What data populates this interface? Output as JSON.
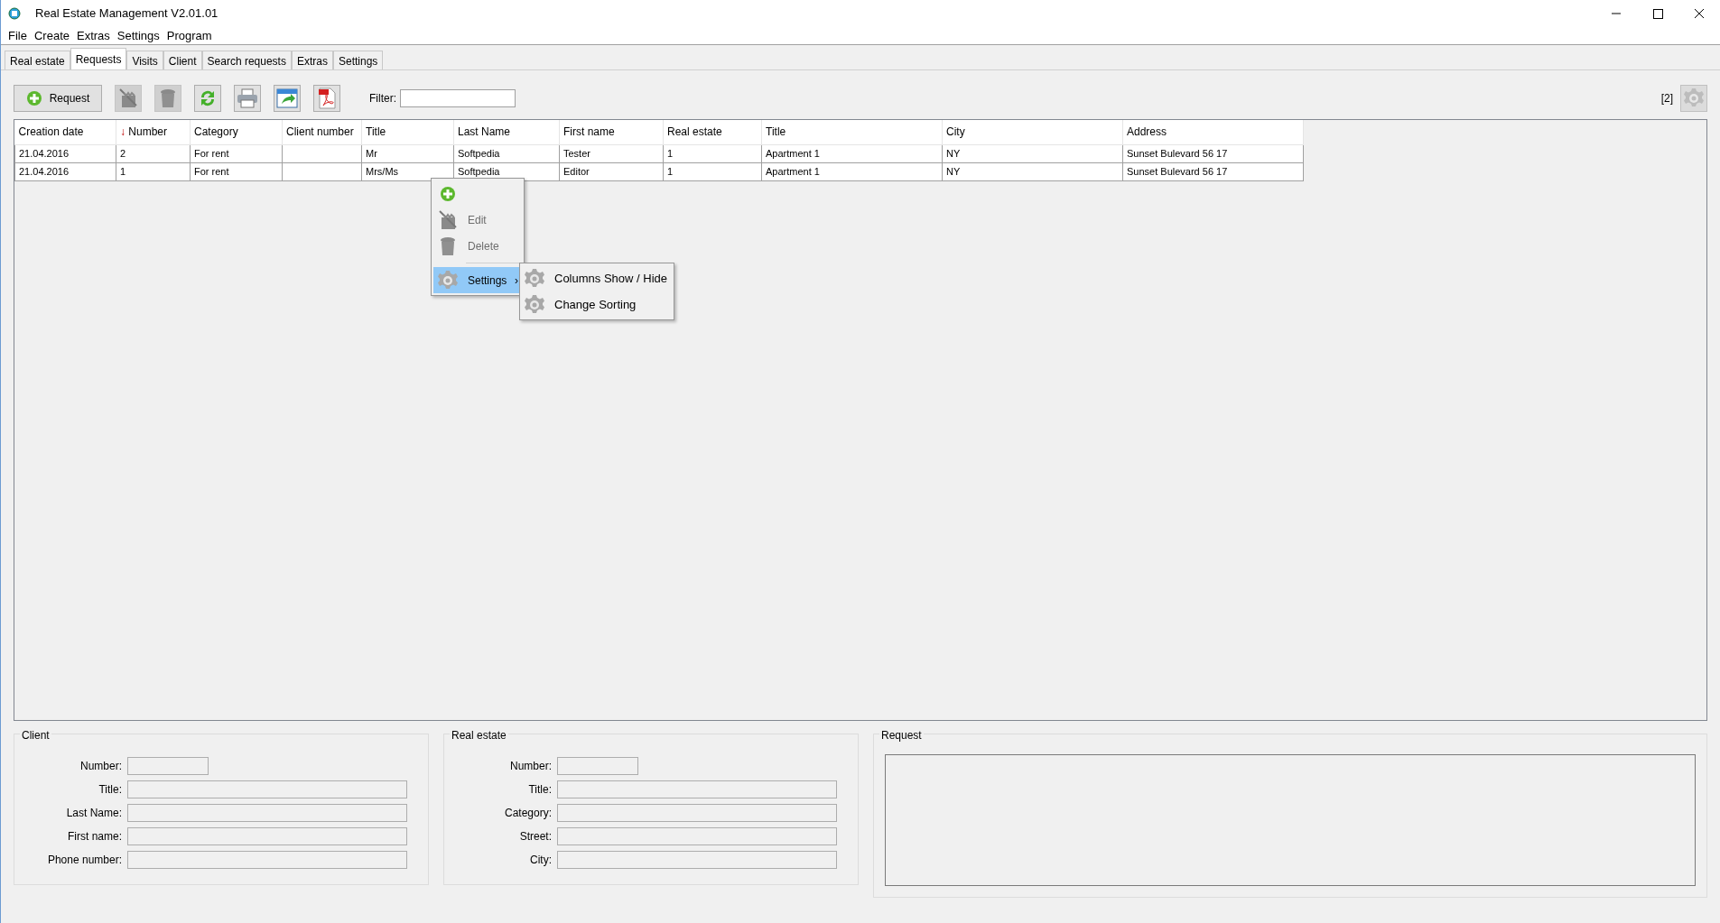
{
  "window": {
    "title": "Real Estate Management V2.01.01"
  },
  "menu": [
    "File",
    "Create",
    "Extras",
    "Settings",
    "Program"
  ],
  "tabs": [
    {
      "label": "Real estate",
      "selected": false
    },
    {
      "label": "Requests",
      "selected": true
    },
    {
      "label": "Visits",
      "selected": false
    },
    {
      "label": "Client",
      "selected": false
    },
    {
      "label": "Search requests",
      "selected": false
    },
    {
      "label": "Extras",
      "selected": false
    },
    {
      "label": "Settings",
      "selected": false
    }
  ],
  "toolbar": {
    "buttons": [
      {
        "kind": "add",
        "label": "Request",
        "disabled": false
      },
      {
        "kind": "edit",
        "disabled": true
      },
      {
        "kind": "delete",
        "disabled": true
      },
      {
        "kind": "refresh",
        "disabled": false
      },
      {
        "kind": "print",
        "disabled": false
      },
      {
        "kind": "export",
        "disabled": false
      },
      {
        "kind": "pdf",
        "disabled": false
      }
    ],
    "filter_label": "Filter:",
    "count": "[2]"
  },
  "table": {
    "columns": [
      {
        "label": "Creation date"
      },
      {
        "label": "Number",
        "sort_mark": "↓"
      },
      {
        "label": "Category"
      },
      {
        "label": "Client number"
      },
      {
        "label": "Title"
      },
      {
        "label": "Last Name"
      },
      {
        "label": "First name"
      },
      {
        "label": "Real estate"
      },
      {
        "label": "Title"
      },
      {
        "label": "City"
      },
      {
        "label": "Address"
      }
    ],
    "rows": [
      [
        "21.04.2016",
        "2",
        "For rent",
        "",
        "Mr",
        "Softpedia",
        "Tester",
        "1",
        "Apartment 1",
        "NY",
        "Sunset Bulevard 56 17"
      ],
      [
        "21.04.2016",
        "1",
        "For rent",
        "",
        "Mrs/Ms",
        "Softpedia",
        "Editor",
        "1",
        "Apartment 1",
        "NY",
        "Sunset Bulevard 56 17"
      ]
    ]
  },
  "context_menu": {
    "items": [
      {
        "kind": "add",
        "disabled": false,
        "selected": false
      },
      {
        "kind": "edit",
        "label": "Edit",
        "disabled": true,
        "selected": false
      },
      {
        "kind": "delete",
        "label": "Delete",
        "disabled": true,
        "selected": false
      },
      {
        "kind": "separator"
      },
      {
        "kind": "settings",
        "label": "Settings",
        "disabled": false,
        "selected": true,
        "submenu_mark": "›"
      }
    ],
    "submenu": [
      "Columns Show / Hide",
      "Change Sorting"
    ]
  },
  "groups": [
    {
      "title": "Client",
      "fields": [
        "Number:",
        "Title:",
        "Last Name:",
        "First name:",
        "Phone number:"
      ]
    },
    {
      "title": "Real estate",
      "fields": [
        "Number:",
        "Title:",
        "Category:",
        "Street:",
        "City:"
      ]
    }
  ],
  "request_group": {
    "title": "Request"
  }
}
